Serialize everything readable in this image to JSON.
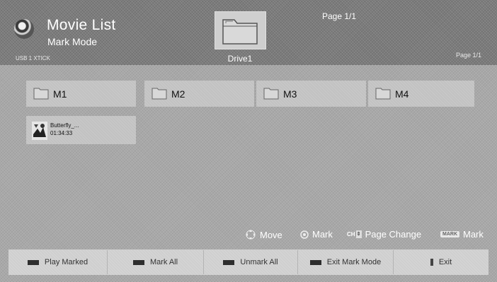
{
  "header": {
    "title": "Movie List",
    "subtitle": "Mark Mode",
    "device": "USB 1 XTICK",
    "drive_label": "Drive1",
    "page_top": "Page 1/1",
    "page_right": "Page 1/1"
  },
  "folders": [
    {
      "name": "M1"
    },
    {
      "name": "M2"
    },
    {
      "name": "M3"
    },
    {
      "name": "M4"
    }
  ],
  "movie": {
    "title": "Butterfly_...",
    "duration": "01:34:33",
    "icon": "movie-thumbnail-icon"
  },
  "help": {
    "move": "Move",
    "mark": "Mark",
    "ch": "CH",
    "page_change": "Page Change",
    "mark_badge": "MARK",
    "mark_key": "Mark"
  },
  "buttons": [
    {
      "label": "Play Marked"
    },
    {
      "label": "Mark All"
    },
    {
      "label": "Unmark All"
    },
    {
      "label": "Exit Mark Mode"
    },
    {
      "label": "Exit"
    }
  ],
  "colors": {
    "background": "#a8a8a8",
    "header": "#7c7c7c",
    "tile": "#c2c2c2",
    "key": "#2e2e2e"
  }
}
